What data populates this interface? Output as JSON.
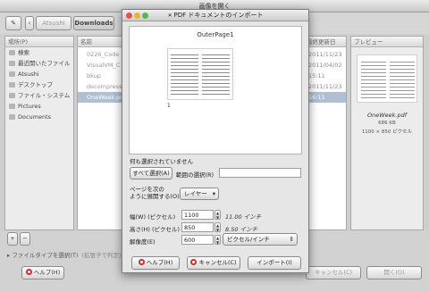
{
  "outer_window": {
    "title": "画像を開く",
    "toolbar": {
      "path_parent": "Atsushi",
      "path_current": "Downloads"
    },
    "sidebar": {
      "header": "場所(P)",
      "items": [
        {
          "label": "検索",
          "icon": "search-icon"
        },
        {
          "label": "最近開いたファイル",
          "icon": "recent-icon"
        },
        {
          "label": "Atsushi",
          "icon": "folder-icon"
        },
        {
          "label": "デスクトップ",
          "icon": "folder-icon"
        },
        {
          "label": "ファイル・システム",
          "icon": "drive-icon"
        },
        {
          "label": "Pictures",
          "icon": "folder-icon"
        },
        {
          "label": "Documents",
          "icon": "folder-icon"
        }
      ]
    },
    "file_list": {
      "header_name": "名前",
      "header_modified": "最終更新日",
      "rows": [
        {
          "name": "0226_Code",
          "date": "2011/11/23"
        },
        {
          "name": "VisualVM_C",
          "date": "2011/04/02"
        },
        {
          "name": "bkup",
          "date": "15:11"
        },
        {
          "name": "decompress",
          "date": "2011/11/23"
        },
        {
          "name": "OneWeek.pdf",
          "date": "16:11"
        }
      ]
    },
    "preview": {
      "header": "プレビュー",
      "filename": "OneWeek.pdf",
      "size": "686 KB",
      "dimensions": "1100 × 850 ピクセル"
    },
    "add_button": "+",
    "remove_button": "−",
    "file_type_label": "ファイルタイプを選択(T)",
    "file_type_value": "(拡張子で判定)",
    "help_button": "ヘルプ(H)",
    "cancel_button": "キャンセル(C)",
    "open_button": "開く(O)"
  },
  "dialog": {
    "title": "PDF ドキュメントのインポート",
    "preview_title": "OuterPage1",
    "page_number": "1",
    "status": "何も選択されていません",
    "select_all_button": "すべて選択(A)",
    "range_label": "範囲の選択(R)",
    "range_value": "",
    "open_pages_label": "ページを次の\nように展開する(O)",
    "open_pages_value": "レイヤー",
    "width_label": "幅(W) (ピクセル)",
    "width_value": "1100",
    "width_unit_text": "11.00 インチ",
    "height_label": "高さ(H) (ピクセル)",
    "height_value": "850",
    "height_unit_text": "8.50 インチ",
    "resolution_label": "解像度(E)",
    "resolution_value": "600",
    "resolution_unit": "ピクセル/インチ",
    "help_button": "ヘルプ(H)",
    "cancel_button": "キャンセル(C)",
    "import_button": "インポート(I)"
  },
  "colors": {
    "close_button": "#e5534b",
    "minimize_button": "#e8b33a",
    "maximize_button": "#55b84f",
    "cancel_ring": "#c9302c"
  }
}
